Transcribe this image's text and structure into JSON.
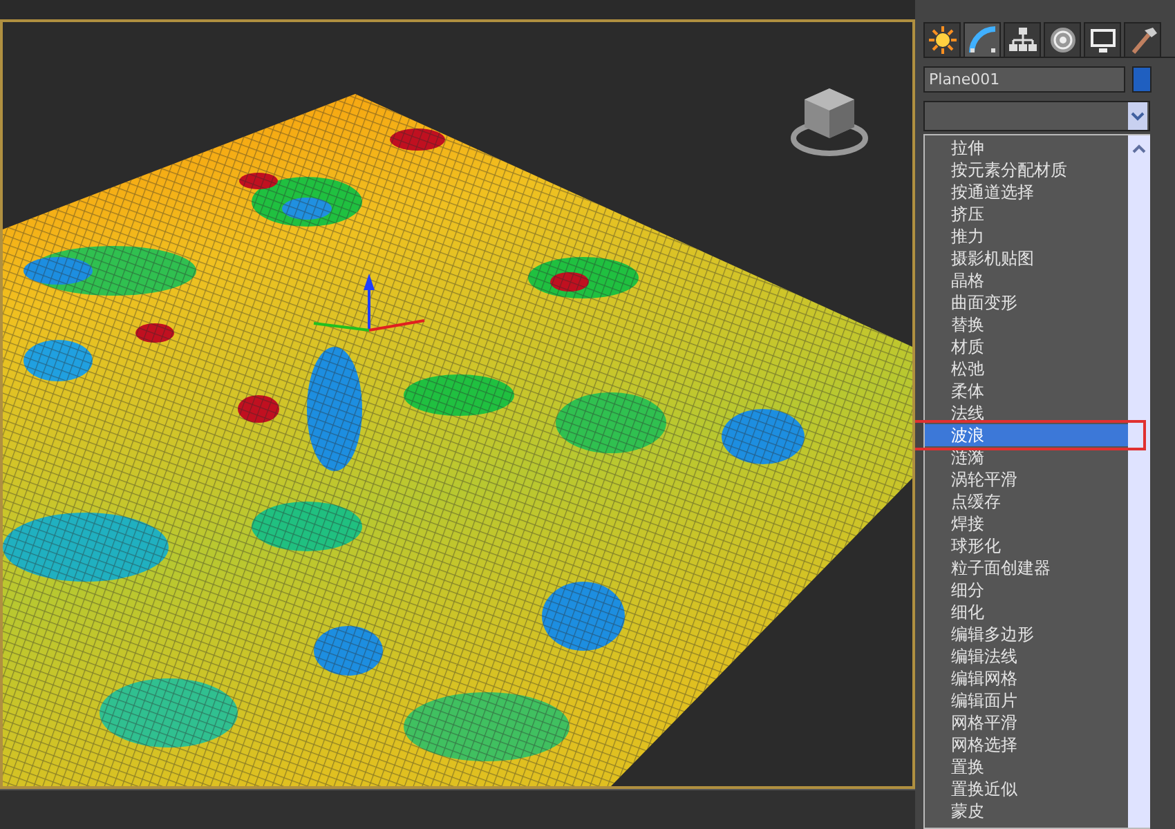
{
  "command_panel": {
    "tabs": [
      {
        "selected": false
      },
      {
        "selected": true
      },
      {
        "selected": false
      },
      {
        "selected": false
      },
      {
        "selected": false
      },
      {
        "selected": false
      }
    ],
    "object_name": "Plane001",
    "modifier_list": {
      "items": [
        {
          "label": "拉伸",
          "selected": false
        },
        {
          "label": "按元素分配材质",
          "selected": false
        },
        {
          "label": "按通道选择",
          "selected": false
        },
        {
          "label": "挤压",
          "selected": false
        },
        {
          "label": "推力",
          "selected": false
        },
        {
          "label": "摄影机贴图",
          "selected": false
        },
        {
          "label": "晶格",
          "selected": false
        },
        {
          "label": "曲面变形",
          "selected": false
        },
        {
          "label": "替换",
          "selected": false
        },
        {
          "label": "材质",
          "selected": false
        },
        {
          "label": "松弛",
          "selected": false
        },
        {
          "label": "柔体",
          "selected": false
        },
        {
          "label": "法线",
          "selected": false
        },
        {
          "label": "波浪",
          "selected": true
        },
        {
          "label": "涟漪",
          "selected": false
        },
        {
          "label": "涡轮平滑",
          "selected": false
        },
        {
          "label": "点缓存",
          "selected": false
        },
        {
          "label": "焊接",
          "selected": false
        },
        {
          "label": "球形化",
          "selected": false
        },
        {
          "label": "粒子面创建器",
          "selected": false
        },
        {
          "label": "细分",
          "selected": false
        },
        {
          "label": "细化",
          "selected": false
        },
        {
          "label": "编辑多边形",
          "selected": false
        },
        {
          "label": "编辑法线",
          "selected": false
        },
        {
          "label": "编辑网格",
          "selected": false
        },
        {
          "label": "编辑面片",
          "selected": false
        },
        {
          "label": "网格平滑",
          "selected": false
        },
        {
          "label": "网格选择",
          "selected": false
        },
        {
          "label": "置换",
          "selected": false
        },
        {
          "label": "置换近似",
          "selected": false
        },
        {
          "label": "蒙皮",
          "selected": false
        }
      ]
    }
  }
}
